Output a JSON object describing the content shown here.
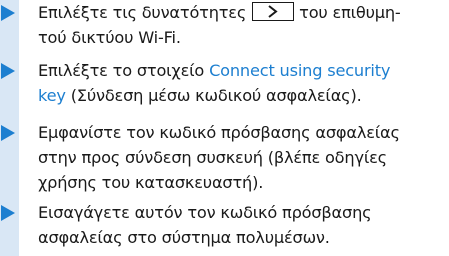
{
  "steps": [
    {
      "line1_before": "Επιλέξτε τις δυνατότητες",
      "button_icon": "chevron-right-icon",
      "line1_after": "του επιθυμη-",
      "line2": "τού δικτύου Wi-Fi."
    },
    {
      "line1_before": "Επιλέξτε το στοιχείο ",
      "link_part1": "Connect using security",
      "link_part2": "key",
      "line2_after": " (Σύνδεση μέσω κωδικού ασφαλείας)."
    },
    {
      "line1": "Εμφανίστε τον κωδικό πρόσβασης ασφαλείας",
      "line2": "στην προς σύνδεση συσκευή (βλέπε οδηγίες",
      "line3": "χρήσης του κατασκευαστή)."
    },
    {
      "line1": "Εισαγάγετε αυτόν τον κωδικό πρόσβασης",
      "line2": "ασφαλείας στο σύστημα πολυμέσων."
    }
  ],
  "colors": {
    "accent": "#1d7fd0",
    "bar": "#d9e7f5",
    "text": "#1a1a1a"
  }
}
